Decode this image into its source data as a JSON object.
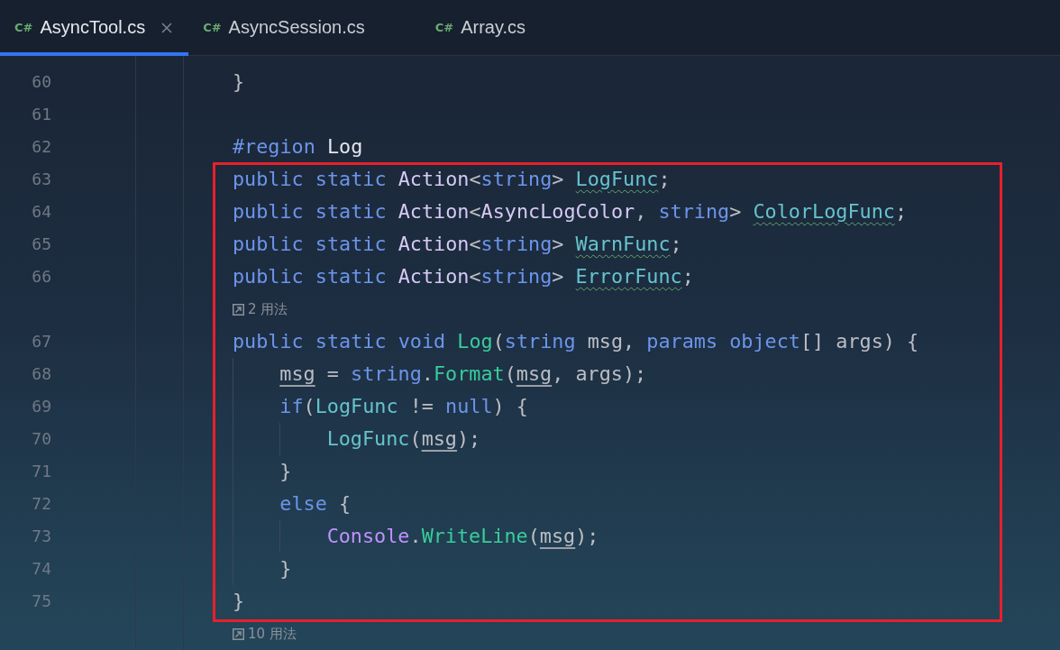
{
  "tabs": [
    {
      "badge": "C#",
      "label": "AsyncTool.cs",
      "selected": true,
      "closable": true
    },
    {
      "badge": "C#",
      "label": "AsyncSession.cs",
      "selected": false,
      "closable": false
    },
    {
      "badge": "C#",
      "label": "Array.cs",
      "selected": false,
      "closable": false
    }
  ],
  "code": {
    "blocks": [
      {
        "highlighted": false,
        "lines": [
          {
            "kind": "code",
            "number": "60",
            "tokens": [
              {
                "text": "}",
                "kind": "plain"
              }
            ]
          },
          {
            "kind": "code",
            "number": "61"
          },
          {
            "kind": "code",
            "number": "62",
            "tokens": [
              {
                "text": "#region",
                "kind": "keyword"
              },
              {
                "text": " Log",
                "kind": "name"
              }
            ]
          }
        ]
      },
      {
        "highlighted": true,
        "lines": [
          {
            "kind": "code",
            "number": "63",
            "tokens": [
              {
                "text": "public static ",
                "kind": "keyword"
              },
              {
                "text": "Action",
                "kind": "type"
              },
              {
                "text": "<",
                "kind": "plain"
              },
              {
                "text": "string",
                "kind": "keyword"
              },
              {
                "text": "> ",
                "kind": "plain"
              },
              {
                "text": "LogFunc",
                "kind": "unused"
              },
              {
                "text": ";",
                "kind": "plain"
              }
            ]
          },
          {
            "kind": "code",
            "number": "64",
            "tokens": [
              {
                "text": "public static ",
                "kind": "keyword"
              },
              {
                "text": "Action",
                "kind": "type"
              },
              {
                "text": "<",
                "kind": "plain"
              },
              {
                "text": "AsyncLogColor",
                "kind": "type"
              },
              {
                "text": ", ",
                "kind": "plain"
              },
              {
                "text": "string",
                "kind": "keyword"
              },
              {
                "text": "> ",
                "kind": "plain"
              },
              {
                "text": "ColorLogFunc",
                "kind": "unused"
              },
              {
                "text": ";",
                "kind": "plain"
              }
            ]
          },
          {
            "kind": "code",
            "number": "65",
            "tokens": [
              {
                "text": "public static ",
                "kind": "keyword"
              },
              {
                "text": "Action",
                "kind": "type"
              },
              {
                "text": "<",
                "kind": "plain"
              },
              {
                "text": "string",
                "kind": "keyword"
              },
              {
                "text": "> ",
                "kind": "plain"
              },
              {
                "text": "WarnFunc",
                "kind": "unused"
              },
              {
                "text": ";",
                "kind": "plain"
              }
            ]
          },
          {
            "kind": "code",
            "number": "66",
            "tokens": [
              {
                "text": "public static ",
                "kind": "keyword"
              },
              {
                "text": "Action",
                "kind": "type"
              },
              {
                "text": "<",
                "kind": "plain"
              },
              {
                "text": "string",
                "kind": "keyword"
              },
              {
                "text": "> ",
                "kind": "plain"
              },
              {
                "text": "ErrorFunc",
                "kind": "unused"
              },
              {
                "text": ";",
                "kind": "plain"
              }
            ]
          },
          {
            "kind": "hint",
            "text": "2 用法"
          },
          {
            "kind": "code",
            "number": "67",
            "tokens": [
              {
                "text": "public static void ",
                "kind": "keyword"
              },
              {
                "text": "Log",
                "kind": "method"
              },
              {
                "text": "(",
                "kind": "plain"
              },
              {
                "text": "string",
                "kind": "keyword"
              },
              {
                "text": " msg, ",
                "kind": "plain"
              },
              {
                "text": "params object",
                "kind": "keyword"
              },
              {
                "text": "[] args) {",
                "kind": "plain"
              }
            ],
            "children": [
              {
                "kind": "code",
                "number": "68",
                "tokens": [
                  {
                    "text": "msg",
                    "kind": "reassigned"
                  },
                  {
                    "text": " = ",
                    "kind": "plain"
                  },
                  {
                    "text": "string",
                    "kind": "keyword"
                  },
                  {
                    "text": ".",
                    "kind": "plain"
                  },
                  {
                    "text": "Format",
                    "kind": "method"
                  },
                  {
                    "text": "(",
                    "kind": "plain"
                  },
                  {
                    "text": "msg",
                    "kind": "reassigned"
                  },
                  {
                    "text": ", args);",
                    "kind": "plain"
                  }
                ]
              },
              {
                "kind": "code",
                "number": "69",
                "tokens": [
                  {
                    "text": "if",
                    "kind": "keyword"
                  },
                  {
                    "text": "(",
                    "kind": "plain"
                  },
                  {
                    "text": "LogFunc",
                    "kind": "field"
                  },
                  {
                    "text": " != ",
                    "kind": "plain"
                  },
                  {
                    "text": "null",
                    "kind": "keyword"
                  },
                  {
                    "text": ") {",
                    "kind": "plain"
                  }
                ],
                "children": [
                  {
                    "kind": "code",
                    "number": "70",
                    "tokens": [
                      {
                        "text": "LogFunc",
                        "kind": "field"
                      },
                      {
                        "text": "(",
                        "kind": "plain"
                      },
                      {
                        "text": "msg",
                        "kind": "reassigned"
                      },
                      {
                        "text": ");",
                        "kind": "plain"
                      }
                    ]
                  }
                ]
              },
              {
                "kind": "code",
                "number": "71",
                "tokens": [
                  {
                    "text": "}",
                    "kind": "plain"
                  }
                ]
              },
              {
                "kind": "code",
                "number": "72",
                "tokens": [
                  {
                    "text": "else",
                    "kind": "keyword"
                  },
                  {
                    "text": " {",
                    "kind": "plain"
                  }
                ],
                "children": [
                  {
                    "kind": "code",
                    "number": "73",
                    "tokens": [
                      {
                        "text": "Console",
                        "kind": "class"
                      },
                      {
                        "text": ".",
                        "kind": "plain"
                      },
                      {
                        "text": "WriteLine",
                        "kind": "method"
                      },
                      {
                        "text": "(",
                        "kind": "plain"
                      },
                      {
                        "text": "msg",
                        "kind": "reassigned"
                      },
                      {
                        "text": ");",
                        "kind": "plain"
                      }
                    ]
                  }
                ]
              },
              {
                "kind": "code",
                "number": "74",
                "tokens": [
                  {
                    "text": "}",
                    "kind": "plain"
                  }
                ]
              }
            ]
          },
          {
            "kind": "code",
            "number": "75",
            "tokens": [
              {
                "text": "}",
                "kind": "plain"
              }
            ]
          }
        ]
      },
      {
        "highlighted": false,
        "lines": [
          {
            "kind": "hint",
            "text": "10 用法"
          }
        ]
      }
    ]
  }
}
